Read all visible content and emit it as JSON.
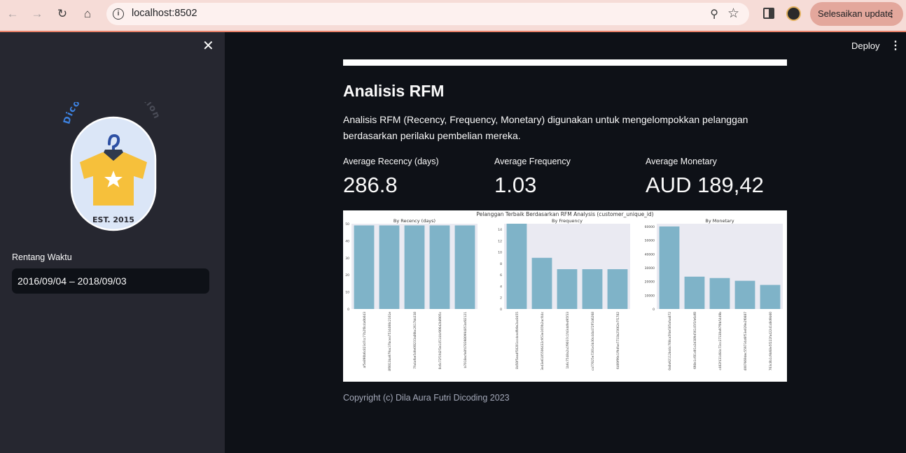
{
  "browser": {
    "url": "localhost:8502",
    "update_label": "Selesaikan update"
  },
  "sidebar": {
    "logo": {
      "arc_text_1": "Dicoding",
      "arc_text_2": "Collection",
      "est": "EST. 2015"
    },
    "date_label": "Rentang Waktu",
    "date_value": "2016/09/04 – 2018/09/03"
  },
  "header": {
    "deploy_label": "Deploy"
  },
  "main": {
    "title": "Analisis RFM",
    "description": "Analisis RFM (Recency, Frequency, Monetary) digunakan untuk mengelompokkan pelanggan berdasarkan perilaku pembelian mereka.",
    "metrics": [
      {
        "label": "Average Recency (days)",
        "value": "286.8"
      },
      {
        "label": "Average Frequency",
        "value": "1.03"
      },
      {
        "label": "Average Monetary",
        "value": "AUD 189,42"
      }
    ],
    "copyright": "Copyright (c) Dila Aura Futri Dicoding 2023"
  },
  "colors": {
    "bar": "#7fb3c8",
    "plot_bg": "#eaeaf2",
    "accent": "#e8826a"
  },
  "chart_data": {
    "type": "bar",
    "title": "Pelanggan Terbaik Berdasarkan RFM Analysis (customer_unique_id)",
    "subplots": [
      {
        "title": "By Recency (days)",
        "categories": [
          "af5e890b6c823d7cc77b2f8c4a0b643",
          "8f0013ba979ac37bcea7534460c2161e",
          "7fa4afbe5dfe6f8233a80bc2617bb338",
          "0c6c72f1fd2f3e145144c906d2b8905c",
          "b7018ecfe8f4783980994853af82121"
        ],
        "values": [
          49,
          49,
          49,
          49,
          49
        ],
        "ylim": [
          0,
          50
        ],
        "yticks": [
          "0",
          "10",
          "20",
          "30",
          "40",
          "50"
        ]
      },
      {
        "title": "By Frequency",
        "categories": [
          "8d50f5eadf50201ccdcedfb9e2ac8455",
          "3e43e6105506432c953e165fb2acf44c",
          "1b6c7548a2a1f9037c1fd3ddfed95f33",
          "ca77025e7201e3b30c44b472ff346268",
          "6469f99c1f9dfae7733b25662e7f1782"
        ],
        "values": [
          15,
          9,
          7,
          7,
          7
        ],
        "ylim": [
          0,
          15
        ],
        "yticks": [
          "0",
          "2",
          "4",
          "6",
          "8",
          "10",
          "12",
          "14"
        ]
      },
      {
        "title": "By Monetary",
        "categories": [
          "0a0a92112bd4c708ca5fde585afaa872",
          "698e1cf81d01a3d389d56145f1fe6df8",
          "c402f431464c72cc27330a97f0b5449b",
          "4007669dec559734d6f53e029e2f0887",
          "763c8b1c9b68e5f222fa422d1d8d9b60"
        ],
        "values": [
          60000,
          23500,
          22500,
          20500,
          17500
        ],
        "ylim": [
          0,
          62000
        ],
        "yticks": [
          "0",
          "10000",
          "20000",
          "30000",
          "40000",
          "50000",
          "60000"
        ]
      }
    ]
  }
}
